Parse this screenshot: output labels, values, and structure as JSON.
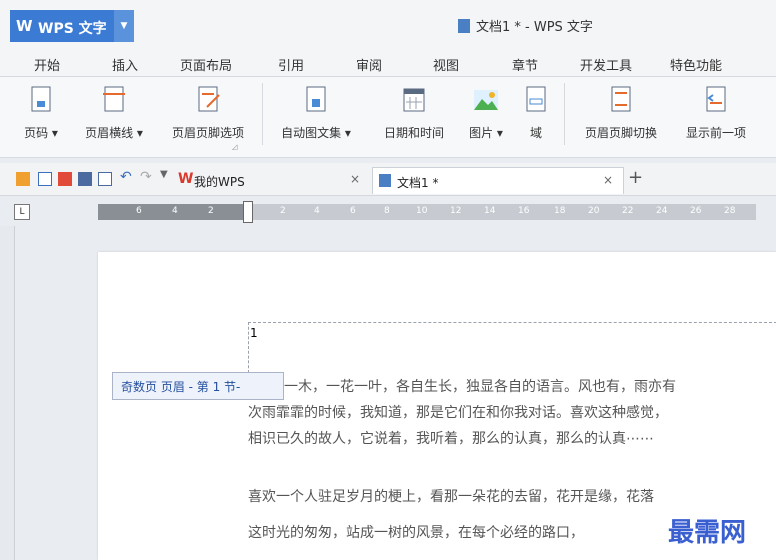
{
  "app": {
    "logo": "W",
    "name": "WPS 文字",
    "document_title": "文档1 * - WPS 文字"
  },
  "menu": [
    "开始",
    "插入",
    "页面布局",
    "引用",
    "审阅",
    "视图",
    "章节",
    "开发工具",
    "特色功能"
  ],
  "ribbon": [
    "页码 ▾",
    "页眉横线 ▾",
    "页眉页脚选项",
    "自动图文集 ▾",
    "日期和时间",
    "图片 ▾",
    "域",
    "页眉页脚切换",
    "显示前一项"
  ],
  "tabs": {
    "home_tab": "我的WPS",
    "doc_tab": "文档1 *",
    "close": "×",
    "new_tab": "+"
  },
  "ruler": {
    "corner": "L",
    "ticks": [
      "6",
      "4",
      "2",
      "2",
      "4",
      "6",
      "8",
      "10",
      "12",
      "14",
      "16",
      "18",
      "20",
      "22",
      "24",
      "26",
      "28"
    ]
  },
  "document": {
    "header_content": "1",
    "header_label": "奇数页 页眉 - 第 1 节-",
    "paragraphs": [
      "一木，一花一叶，各自生长，独显各自的语言。风也有，雨亦有",
      "次雨霏霏的时候，我知道，那是它们在和你我对话。喜欢这种感觉，",
      "相识已久的故人，它说着，我听着，那么的认真，那么的认真⋯⋯",
      "喜欢一个人驻足岁月的梗上，看那一朵花的去留，花开是缘，花落",
      "这时光的匆匆，站成一树的风景，在每个必经的路口，"
    ]
  },
  "watermark": "最需网",
  "colors": {
    "accent": "#3b7bd4",
    "header_label_text": "#244f9e"
  }
}
